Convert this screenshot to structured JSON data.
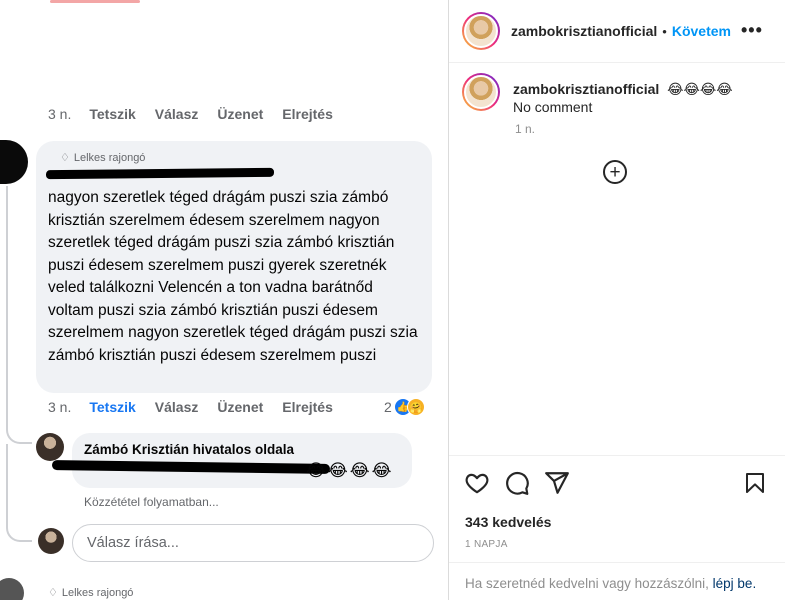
{
  "facebook": {
    "comment1_actions": {
      "time": "3 n.",
      "like": "Tetszik",
      "reply": "Válasz",
      "message": "Üzenet",
      "hide": "Elrejtés"
    },
    "comment2": {
      "badge": "Lelkes rajongó",
      "text": "nagyon szeretlek téged drágám puszi szia zámbó krisztián szerelmem édesem szerelmem nagyon szeretlek téged drágám puszi szia zámbó krisztián puszi édesem szerelmem puszi gyerek szeretnék veled találkozni Velencén a ton vadna barátnőd voltam puszi szia zámbó krisztián puszi édesem szerelmem nagyon szeretlek téged drágám puszi szia zámbó krisztián puszi édesem szerelmem puszi",
      "actions": {
        "time": "3 n.",
        "like": "Tetszik",
        "reply": "Válasz",
        "message": "Üzenet",
        "hide": "Elrejtés"
      },
      "reaction_count": "2",
      "reaction_icons": [
        "like-icon",
        "care-icon"
      ]
    },
    "reply": {
      "author": "Zámbó Krisztián hivatalos oldala",
      "emojis": "😂😂😂😂",
      "status": "Közzététel folyamatban..."
    },
    "reply_input": {
      "placeholder": "Válasz írása..."
    },
    "next_comment": {
      "badge": "Lelkes rajongó"
    },
    "colors": {
      "link_blue": "#1877f2",
      "meta_gray": "#65676b",
      "bubble_bg": "#f0f2f5"
    }
  },
  "instagram": {
    "header": {
      "username": "zambokrisztianofficial",
      "separator": "•",
      "follow_label": "Követem",
      "more_label": "•••"
    },
    "caption": {
      "username": "zambokrisztianofficial",
      "emojis": "😂😂😂😂",
      "text": "No comment",
      "time": "1 n."
    },
    "load_more_icon": "plus-circle-icon",
    "action_icons": [
      "heart-icon",
      "comment-icon",
      "share-icon",
      "bookmark-icon"
    ],
    "likes": "343 kedvelés",
    "date": "1 NAPJA",
    "login_prompt": {
      "text": "Ha szeretnéd kedvelni vagy hozzászólni,",
      "link": "lépj be."
    },
    "colors": {
      "follow_blue": "#0095f6",
      "text_dark": "#262626",
      "meta_gray": "#8e8e8e"
    }
  }
}
